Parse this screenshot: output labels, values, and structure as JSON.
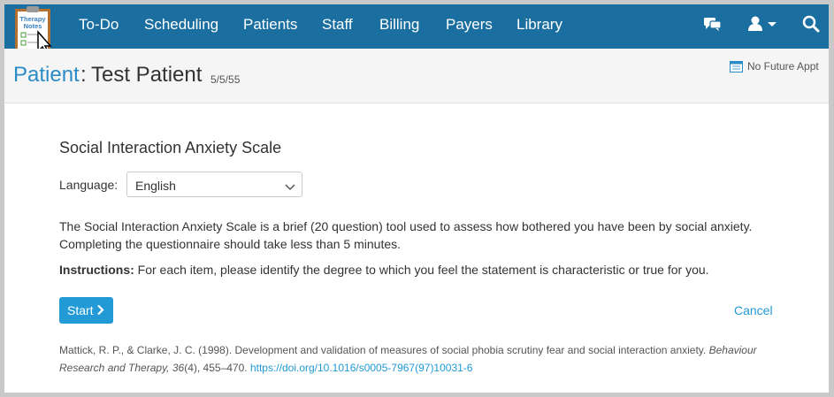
{
  "nav": {
    "logo_text": [
      "Therapy",
      "Notes"
    ],
    "items": [
      "To-Do",
      "Scheduling",
      "Patients",
      "Staff",
      "Billing",
      "Payers",
      "Library"
    ],
    "icons": [
      "chat-icon",
      "user-icon",
      "search-icon"
    ],
    "bar_color": "#1b6fa0"
  },
  "patient_header": {
    "prefix": "Patient",
    "separator": ":",
    "name": "Test Patient",
    "dob": "5/5/55",
    "appointment": "No Future Appt"
  },
  "assessment": {
    "title": "Social Interaction Anxiety Scale",
    "language_label": "Language:",
    "language_value": "English",
    "description": "The Social Interaction Anxiety Scale is a brief (20 question) tool used to assess how bothered you have been by social anxiety. Completing the questionnaire should take less than 5 minutes.",
    "instructions_label": "Instructions:",
    "instructions_text": "For each item, please identify the degree to which you feel the statement is characteristic or true for you.",
    "start_label": "Start",
    "cancel_label": "Cancel",
    "citation": {
      "authors": "Mattick, R. P., & Clarke, J. C. (1998). Development and validation of measures of social phobia scrutiny fear and social interaction anxiety.",
      "journal": "Behaviour Research and Therapy,",
      "volume": "36",
      "issue_pages": "(4), 455–470.",
      "doi": "https://doi.org/10.1016/s0005-7967(97)10031-6"
    },
    "accent_color": "#229ad6"
  }
}
